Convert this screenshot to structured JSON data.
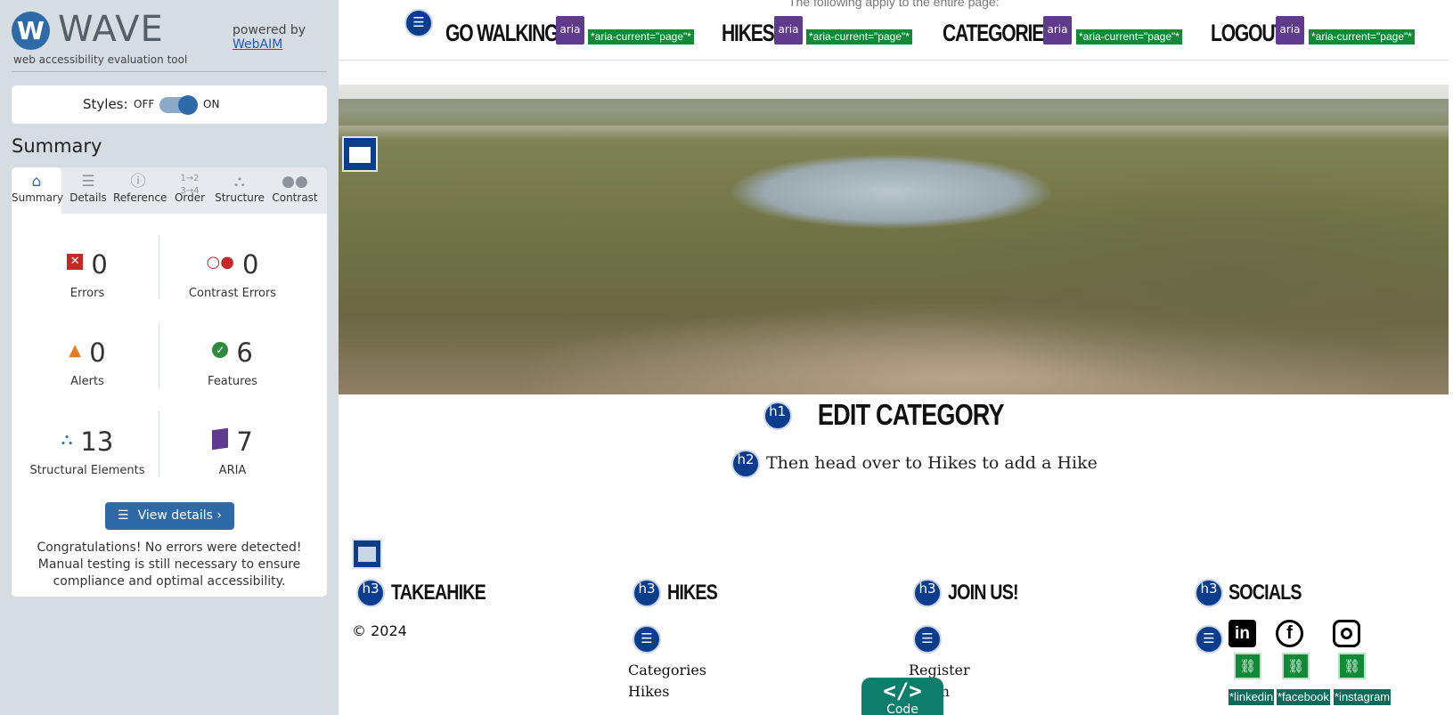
{
  "wave": {
    "logo_letter": "W",
    "brand_name": "WAVE",
    "tagline": "web accessibility evaluation tool",
    "powered_by": "powered by",
    "powered_link": "WebAIM",
    "styles_label": "Styles:",
    "styles_off": "OFF",
    "styles_on": "ON",
    "summary_heading": "Summary",
    "tabs": [
      {
        "label": "Summary",
        "icon": "home-icon",
        "active": true
      },
      {
        "label": "Details",
        "icon": "list-icon"
      },
      {
        "label": "Reference",
        "icon": "info-icon"
      },
      {
        "label": "Order",
        "icon": "order-icon"
      },
      {
        "label": "Structure",
        "icon": "structure-icon"
      },
      {
        "label": "Contrast",
        "icon": "contrast-icon"
      }
    ],
    "stats": {
      "errors": {
        "value": "0",
        "label": "Errors",
        "color": "#c62828"
      },
      "contrast_errors": {
        "value": "0",
        "label": "Contrast Errors",
        "color": "#c62828"
      },
      "alerts": {
        "value": "0",
        "label": "Alerts",
        "color": "#e87a1d"
      },
      "features": {
        "value": "6",
        "label": "Features",
        "color": "#2e8b3d"
      },
      "structural": {
        "value": "13",
        "label": "Structural Elements",
        "color": "#2f6aa8"
      },
      "aria": {
        "value": "7",
        "label": "ARIA",
        "color": "#5f3a8e"
      }
    },
    "view_details": "View details ›",
    "congrats": "Congratulations! No errors were detected! Manual testing is still necessary to ensure compliance and optimal accessibility."
  },
  "page": {
    "entire_page_note": "The following apply to the entire page:",
    "nav": [
      {
        "label": "GO WALKING!",
        "aria_badge": "aria",
        "aria_current": "*aria-current=\"page\"*"
      },
      {
        "label": "HIKES",
        "aria_badge": "aria",
        "aria_current": "*aria-current=\"page\"*"
      },
      {
        "label": "CATEGORIES",
        "aria_badge": "aria",
        "aria_current": "*aria-current=\"page\"*"
      },
      {
        "label": "LOGOUT",
        "aria_badge": "aria",
        "aria_current": "*aria-current=\"page\"*"
      }
    ],
    "h1_badge": "h1",
    "h1": "EDIT CATEGORY",
    "h2_badge": "h2",
    "h2": "Then head over to Hikes to add a Hike",
    "footer": {
      "h3_badge": "h3",
      "col1_heading": "TAKEAHIKE",
      "copyright": "© 2024",
      "col2_heading": "HIKES",
      "col2_links": [
        "Categories",
        "Hikes"
      ],
      "col3_heading": "JOIN US!",
      "col3_links": [
        "Register",
        "Login"
      ],
      "col4_heading": "SOCIALS",
      "socials": [
        {
          "icon": "linkedin-icon",
          "glyph": "in",
          "label": "*linkedin"
        },
        {
          "icon": "facebook-icon",
          "glyph": "f",
          "label": "*facebook"
        },
        {
          "icon": "instagram-icon",
          "glyph": "",
          "label": "*instagram"
        }
      ]
    },
    "code_button_icon": "</>",
    "code_button_label": "Code"
  }
}
